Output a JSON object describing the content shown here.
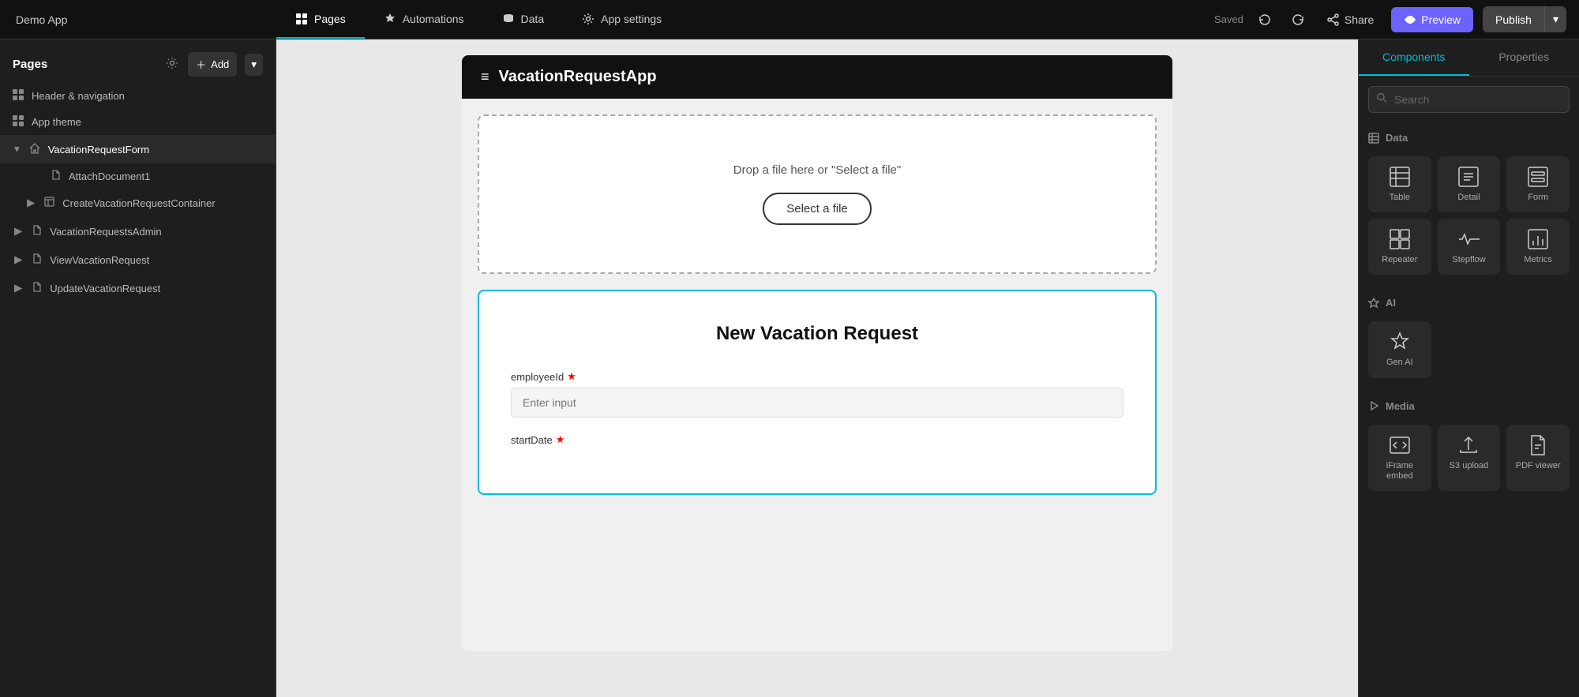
{
  "app": {
    "title": "Demo App"
  },
  "topbar": {
    "nav_items": [
      {
        "id": "pages",
        "label": "Pages",
        "active": true
      },
      {
        "id": "automations",
        "label": "Automations",
        "active": false
      },
      {
        "id": "data",
        "label": "Data",
        "active": false
      },
      {
        "id": "app_settings",
        "label": "App settings",
        "active": false
      }
    ],
    "saved_label": "Saved",
    "share_label": "Share",
    "preview_label": "Preview",
    "publish_label": "Publish"
  },
  "sidebar": {
    "title": "Pages",
    "add_label": "Add",
    "items": [
      {
        "id": "header-nav",
        "label": "Header & navigation",
        "level": 0,
        "icon": "grid"
      },
      {
        "id": "app-theme",
        "label": "App theme",
        "level": 0,
        "icon": "grid"
      },
      {
        "id": "vacation-request-form",
        "label": "VacationRequestForm",
        "level": 0,
        "icon": "home",
        "active": true,
        "expanded": true
      },
      {
        "id": "attach-document1",
        "label": "AttachDocument1",
        "level": 2,
        "icon": "file"
      },
      {
        "id": "create-vacation-container",
        "label": "CreateVacationRequestContainer",
        "level": 1,
        "icon": "layout"
      },
      {
        "id": "vacation-requests-admin",
        "label": "VacationRequestsAdmin",
        "level": 0,
        "icon": "file"
      },
      {
        "id": "view-vacation-request",
        "label": "ViewVacationRequest",
        "level": 0,
        "icon": "file"
      },
      {
        "id": "update-vacation-request",
        "label": "UpdateVacationRequest",
        "level": 0,
        "icon": "file"
      }
    ]
  },
  "canvas": {
    "app_header_title": "VacationRequestApp",
    "file_drop_text": "Drop a file here or \"Select a file\"",
    "select_file_label": "Select a file",
    "form_title": "New Vacation Request",
    "employee_id_label": "employeeId",
    "employee_id_placeholder": "Enter input",
    "start_date_label": "startDate"
  },
  "right_panel": {
    "tabs": [
      {
        "id": "components",
        "label": "Components",
        "active": true
      },
      {
        "id": "properties",
        "label": "Properties",
        "active": false
      }
    ],
    "search_placeholder": "Search",
    "sections": [
      {
        "id": "data",
        "label": "Data",
        "items": [
          {
            "id": "table",
            "label": "Table"
          },
          {
            "id": "detail",
            "label": "Detail"
          },
          {
            "id": "form",
            "label": "Form"
          },
          {
            "id": "repeater",
            "label": "Repeater"
          },
          {
            "id": "stepflow",
            "label": "Stepflow"
          },
          {
            "id": "metrics",
            "label": "Metrics"
          }
        ]
      },
      {
        "id": "ai",
        "label": "AI",
        "items": [
          {
            "id": "gen-ai",
            "label": "Gen AI"
          }
        ]
      },
      {
        "id": "media",
        "label": "Media",
        "items": [
          {
            "id": "iframe-embed",
            "label": "iFrame embed"
          },
          {
            "id": "s3-upload",
            "label": "S3 upload"
          },
          {
            "id": "pdf-viewer",
            "label": "PDF viewer"
          }
        ]
      }
    ]
  }
}
